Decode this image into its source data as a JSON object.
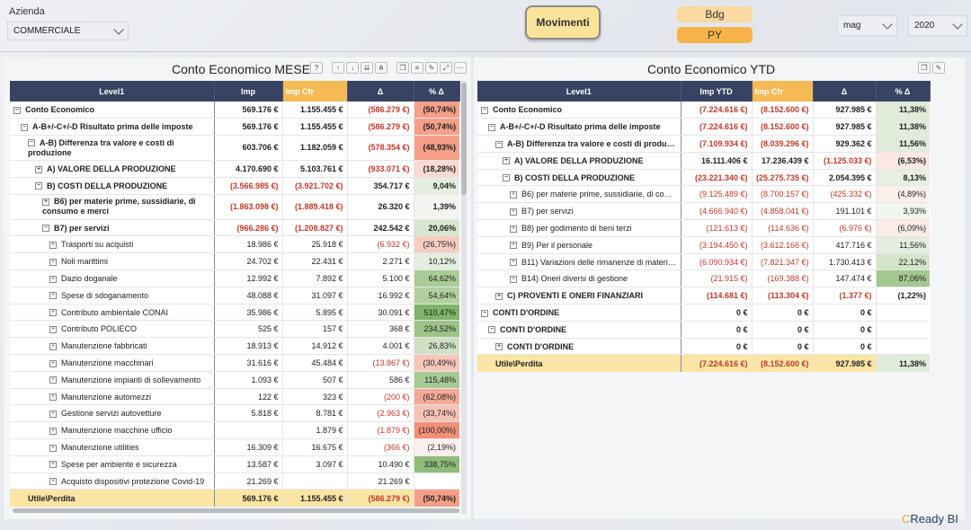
{
  "filters": {
    "azienda_label": "Azienda",
    "azienda_value": "COMMERCIALE",
    "month_value": "mag",
    "year_value": "2020"
  },
  "buttons": {
    "movimenti": "Movimenti",
    "bdg": "Bdg",
    "py": "PY"
  },
  "branding": {
    "logo_prefix": "C",
    "logo_text": "Ready BI"
  },
  "mese": {
    "title": "Conto Economico MESE",
    "columns": [
      "Level1",
      "Imp",
      "Imp Cfr",
      "Δ",
      "% Δ"
    ],
    "rows": [
      {
        "label": "Conto Economico",
        "indent": 0,
        "tog": "−",
        "bold": true,
        "imp": "569.176 €",
        "cfr": "1.155.455 €",
        "delta": "(586.279 €)",
        "pct": "(50,74%)",
        "pct_color": "#f59f89"
      },
      {
        "label": "A-B+/-C+/-D Risultato prima delle imposte",
        "indent": 1,
        "tog": "−",
        "bold": true,
        "imp": "569.176 €",
        "cfr": "1.155.455 €",
        "delta": "(586.279 €)",
        "pct": "(50,74%)",
        "pct_color": "#f59f89"
      },
      {
        "label": "A-B) Differenza tra valore e costi di produzione",
        "indent": 2,
        "tog": "−",
        "bold": true,
        "tall": true,
        "imp": "603.706 €",
        "cfr": "1.182.059 €",
        "delta": "(578.354 €)",
        "pct": "(48,93%)",
        "pct_color": "#f59f89"
      },
      {
        "label": "A) VALORE DELLA PRODUZIONE",
        "indent": 3,
        "tog": "+",
        "bold": true,
        "imp": "4.170.690 €",
        "cfr": "5.103.761 €",
        "delta": "(933.071 €)",
        "pct": "(18,28%)",
        "pct_color": "#f9dad2"
      },
      {
        "label": "B) COSTI DELLA PRODUZIONE",
        "indent": 3,
        "tog": "−",
        "bold": true,
        "imp": "(3.566.985 €)",
        "cfr": "(3.921.702 €)",
        "delta": "354.717 €",
        "pct": "9,04%",
        "pct_color": "#e5eedf"
      },
      {
        "label": "B6) per materie prime, sussidiarie, di consumo e merci",
        "indent": 4,
        "tog": "+",
        "bold": true,
        "tall": true,
        "imp": "(1.863.098 €)",
        "cfr": "(1.889.418 €)",
        "delta": "26.320 €",
        "pct": "1,39%",
        "pct_color": "#f3f5f1"
      },
      {
        "label": "B7) per servizi",
        "indent": 4,
        "tog": "−",
        "bold": true,
        "imp": "(966.286 €)",
        "cfr": "(1.208.827 €)",
        "delta": "242.542 €",
        "pct": "20,06%",
        "pct_color": "#d8e6cd"
      },
      {
        "label": "Trasporti su acquisti",
        "indent": 5,
        "tog": "+",
        "bold": false,
        "imp": "18.986 €",
        "cfr": "25.918 €",
        "delta": "(6.932 €)",
        "pct": "(26,75%)",
        "pct_color": "#f7cdc2"
      },
      {
        "label": "Noli marittimi",
        "indent": 5,
        "tog": "+",
        "bold": false,
        "imp": "24.702 €",
        "cfr": "22.431 €",
        "delta": "2.271 €",
        "pct": "10,12%",
        "pct_color": "#e4edde"
      },
      {
        "label": "Dazio doganale",
        "indent": 5,
        "tog": "+",
        "bold": false,
        "imp": "12.992 €",
        "cfr": "7.892 €",
        "delta": "5.100 €",
        "pct": "64,62%",
        "pct_color": "#a9cc95"
      },
      {
        "label": "Spese di sdoganamento",
        "indent": 5,
        "tog": "+",
        "bold": false,
        "imp": "48.088 €",
        "cfr": "31.097 €",
        "delta": "16.992 €",
        "pct": "54,64%",
        "pct_color": "#b2d19f"
      },
      {
        "label": "Contributo ambientale CONAI",
        "indent": 5,
        "tog": "+",
        "bold": false,
        "imp": "35.986 €",
        "cfr": "5.895 €",
        "delta": "30.091 €",
        "pct": "510,47%",
        "pct_color": "#7fb46a"
      },
      {
        "label": "Contributo POLIECO",
        "indent": 5,
        "tog": "+",
        "bold": false,
        "imp": "525 €",
        "cfr": "157 €",
        "delta": "368 €",
        "pct": "234,52%",
        "pct_color": "#9cc487"
      },
      {
        "label": "Manutenzione fabbricati",
        "indent": 5,
        "tog": "+",
        "bold": false,
        "imp": "18.913 €",
        "cfr": "14.912 €",
        "delta": "4.001 €",
        "pct": "26,83%",
        "pct_color": "#cfe0c3"
      },
      {
        "label": "Manutenzione macchinari",
        "indent": 5,
        "tog": "+",
        "bold": false,
        "imp": "31.616 €",
        "cfr": "45.484 €",
        "delta": "(13.867 €)",
        "pct": "(30,49%)",
        "pct_color": "#f6c6b9"
      },
      {
        "label": "Manutenzione impianti di sollevamento",
        "indent": 5,
        "tog": "+",
        "bold": false,
        "imp": "1.093 €",
        "cfr": "507 €",
        "delta": "586 €",
        "pct": "115,48%",
        "pct_color": "#a6ca92"
      },
      {
        "label": "Manutenzione automezzi",
        "indent": 5,
        "tog": "+",
        "bold": false,
        "imp": "122 €",
        "cfr": "323 €",
        "delta": "(200 €)",
        "pct": "(62,08%)",
        "pct_color": "#f4a996"
      },
      {
        "label": "Gestione servizi autovetture",
        "indent": 5,
        "tog": "+",
        "bold": false,
        "imp": "5.818 €",
        "cfr": "8.781 €",
        "delta": "(2.963 €)",
        "pct": "(33,74%)",
        "pct_color": "#f6c3b6"
      },
      {
        "label": "Manutenzione macchine ufficio",
        "indent": 5,
        "tog": "+",
        "bold": false,
        "imp": "",
        "cfr": "1.879 €",
        "delta": "(1.879 €)",
        "pct": "(100,00%)",
        "pct_color": "#f28f78"
      },
      {
        "label": "Manutenzione utilities",
        "indent": 5,
        "tog": "+",
        "bold": false,
        "imp": "16.309 €",
        "cfr": "16.675 €",
        "delta": "(366 €)",
        "pct": "(2,19%)",
        "pct_color": "#fbf0ed"
      },
      {
        "label": "Spese per ambiente e sicurezza",
        "indent": 5,
        "tog": "+",
        "bold": false,
        "imp": "13.587 €",
        "cfr": "3.097 €",
        "delta": "10.490 €",
        "pct": "338,75%",
        "pct_color": "#8fbd79"
      },
      {
        "label": "Acquisto dispositivi protezione Covid-19",
        "indent": 5,
        "tog": "+",
        "bold": false,
        "imp": "21.269 €",
        "cfr": "",
        "delta": "21.269 €",
        "pct": "",
        "pct_color": "#ffffff"
      }
    ],
    "total": {
      "label": "Utile\\Perdita",
      "imp": "569.176 €",
      "cfr": "1.155.455 €",
      "delta": "(586.279 €)",
      "pct": "(50,74%)",
      "pct_color": "#f59f89"
    }
  },
  "ytd": {
    "title": "Conto Economico YTD",
    "columns": [
      "Level1",
      "Imp YTD",
      "Imp Cfr",
      "Δ",
      "% Δ"
    ],
    "rows": [
      {
        "label": "Conto Economico",
        "indent": 0,
        "tog": "−",
        "bold": true,
        "imp": "(7.224.616 €)",
        "cfr": "(8.152.600 €)",
        "delta": "927.985 €",
        "pct": "11,38%",
        "pct_color": "#e1ebd9"
      },
      {
        "label": "A-B+/-C+/-D Risultato prima delle imposte",
        "indent": 1,
        "tog": "−",
        "bold": true,
        "imp": "(7.224.616 €)",
        "cfr": "(8.152.600 €)",
        "delta": "927.985 €",
        "pct": "11,38%",
        "pct_color": "#e1ebd9"
      },
      {
        "label": "A-B) Differenza tra valore e costi di produzione",
        "indent": 2,
        "tog": "−",
        "bold": true,
        "imp": "(7.109.934 €)",
        "cfr": "(8.039.296 €)",
        "delta": "929.362 €",
        "pct": "11,56%",
        "pct_color": "#e1ebd9"
      },
      {
        "label": "A) VALORE DELLA PRODUZIONE",
        "indent": 3,
        "tog": "+",
        "bold": true,
        "imp": "16.111.406 €",
        "cfr": "17.236.439 €",
        "delta": "(1.125.033 €)",
        "pct": "(6,53%)",
        "pct_color": "#fbe8e3"
      },
      {
        "label": "B) COSTI DELLA PRODUZIONE",
        "indent": 3,
        "tog": "−",
        "bold": true,
        "imp": "(23.221.340 €)",
        "cfr": "(25.275.735 €)",
        "delta": "2.054.395 €",
        "pct": "8,13%",
        "pct_color": "#e8efe2"
      },
      {
        "label": "B6) per materie prime, sussidiarie, di consumo e merci",
        "indent": 4,
        "tog": "+",
        "bold": false,
        "imp": "(9.125.489 €)",
        "cfr": "(8.700.157 €)",
        "delta": "(425.332 €)",
        "pct": "(4,89%)",
        "pct_color": "#fcf0ec"
      },
      {
        "label": "B7) per servizi",
        "indent": 4,
        "tog": "+",
        "bold": false,
        "imp": "(4.666.940 €)",
        "cfr": "(4.858.041 €)",
        "delta": "191.101 €",
        "pct": "3,93%",
        "pct_color": "#f2f6ef"
      },
      {
        "label": "B8) per godimento di beni terzi",
        "indent": 4,
        "tog": "+",
        "bold": false,
        "imp": "(121.613 €)",
        "cfr": "(114.636 €)",
        "delta": "(6.976 €)",
        "pct": "(6,09%)",
        "pct_color": "#fbece8"
      },
      {
        "label": "B9) Per il personale",
        "indent": 4,
        "tog": "+",
        "bold": false,
        "imp": "(3.194.450 €)",
        "cfr": "(3.612.166 €)",
        "delta": "417.716 €",
        "pct": "11,56%",
        "pct_color": "#e4edde"
      },
      {
        "label": "B11) Variazioni delle rimanenze di materie prime",
        "indent": 4,
        "tog": "+",
        "bold": false,
        "imp": "(6.090.934 €)",
        "cfr": "(7.821.347 €)",
        "delta": "1.730.413 €",
        "pct": "22,12%",
        "pct_color": "#d4e4c8"
      },
      {
        "label": "B14) Oneri diversi di gestione",
        "indent": 4,
        "tog": "+",
        "bold": false,
        "imp": "(21.915 €)",
        "cfr": "(169.388 €)",
        "delta": "147.474 €",
        "pct": "87,06%",
        "pct_color": "#a3c88f"
      },
      {
        "label": "C) PROVENTI E ONERI FINANZIARI",
        "indent": 2,
        "tog": "+",
        "bold": true,
        "imp": "(114.681 €)",
        "cfr": "(113.304 €)",
        "delta": "(1.377 €)",
        "pct": "(1,22%)",
        "pct_color": "#ffffff"
      },
      {
        "label": "CONTI D'ORDINE",
        "indent": 0,
        "tog": "−",
        "bold": true,
        "imp": "0 €",
        "cfr": "0 €",
        "delta": "0 €",
        "pct": "",
        "pct_color": "#ffffff"
      },
      {
        "label": "CONTI D'ORDINE",
        "indent": 1,
        "tog": "−",
        "bold": true,
        "imp": "0 €",
        "cfr": "0 €",
        "delta": "0 €",
        "pct": "",
        "pct_color": "#ffffff"
      },
      {
        "label": "CONTI D'ORDINE",
        "indent": 2,
        "tog": "+",
        "bold": true,
        "imp": "0 €",
        "cfr": "0 €",
        "delta": "0 €",
        "pct": "",
        "pct_color": "#ffffff"
      }
    ],
    "total": {
      "label": "Utile\\Perdita",
      "imp": "(7.224.616 €)",
      "cfr": "(8.152.600 €)",
      "delta": "927.985 €",
      "pct": "11,38%",
      "pct_color": "#e1ebd9"
    }
  },
  "colors": {
    "header": "#384364",
    "cfr_header": "#f6ba54",
    "total_row": "#fbe5a4",
    "negative": "#c0392b"
  }
}
